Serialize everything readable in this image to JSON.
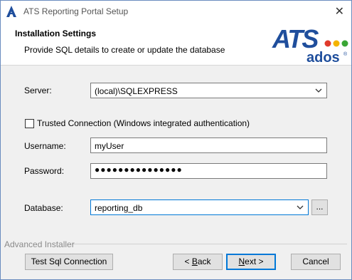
{
  "window": {
    "title": "ATS Reporting Portal Setup",
    "close_glyph": "✕"
  },
  "header": {
    "title": "Installation Settings",
    "subtitle": "Provide SQL details to create or update the database",
    "logo": {
      "top_text": "ATS",
      "bottom_text": "ados",
      "registered": "®",
      "dot_colors": [
        "#e03a2b",
        "#f4b400",
        "#3aa635"
      ]
    }
  },
  "form": {
    "server": {
      "label": "Server:",
      "value": "(local)\\SQLEXPRESS"
    },
    "trusted": {
      "label": "Trusted Connection (Windows integrated authentication)",
      "checked": false
    },
    "username": {
      "label": "Username:",
      "value": "myUser"
    },
    "password": {
      "label": "Password:",
      "masked_value": "●●●●●●●●●●●●●●●"
    },
    "database": {
      "label": "Database:",
      "value": "reporting_db",
      "browse_label": "..."
    }
  },
  "footer": {
    "brand": "Advanced Installer",
    "test_button": "Test Sql Connection",
    "back_button": {
      "prefix": "< ",
      "mnemonic": "B",
      "rest": "ack"
    },
    "next_button": {
      "mnemonic": "N",
      "rest": "ext >"
    },
    "cancel_button": "Cancel"
  },
  "colors": {
    "brand_blue": "#1f4e9c",
    "focus_blue": "#0078d7"
  }
}
